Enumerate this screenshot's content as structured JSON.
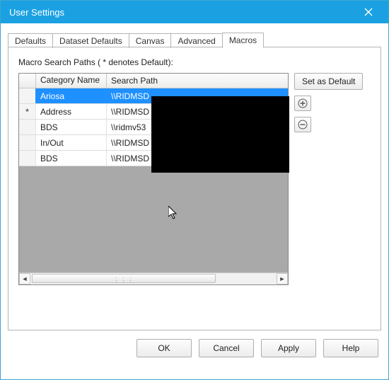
{
  "window": {
    "title": "User Settings"
  },
  "tabs": {
    "items": [
      {
        "label": "Defaults"
      },
      {
        "label": "Dataset Defaults"
      },
      {
        "label": "Canvas"
      },
      {
        "label": "Advanced"
      },
      {
        "label": "Macros"
      }
    ],
    "active_index": 4
  },
  "macros": {
    "section_label": "Macro Search Paths ( * denotes Default):",
    "columns": {
      "star": "",
      "category": "Category Name",
      "path": "Search Path"
    },
    "rows": [
      {
        "default": "",
        "category": "Ariosa",
        "path": "\\\\RIDMSD",
        "selected": true
      },
      {
        "default": "*",
        "category": "Address",
        "path": "\\\\RIDMSD",
        "selected": false
      },
      {
        "default": "",
        "category": "BDS",
        "path": "\\\\ridmv53",
        "selected": false
      },
      {
        "default": "",
        "category": "In/Out",
        "path": "\\\\RIDMSD",
        "selected": false
      },
      {
        "default": "",
        "category": "BDS",
        "path": "\\\\RIDMSD",
        "selected": false
      }
    ],
    "set_default_label": "Set as Default"
  },
  "footer": {
    "ok": "OK",
    "cancel": "Cancel",
    "apply": "Apply",
    "help": "Help"
  }
}
